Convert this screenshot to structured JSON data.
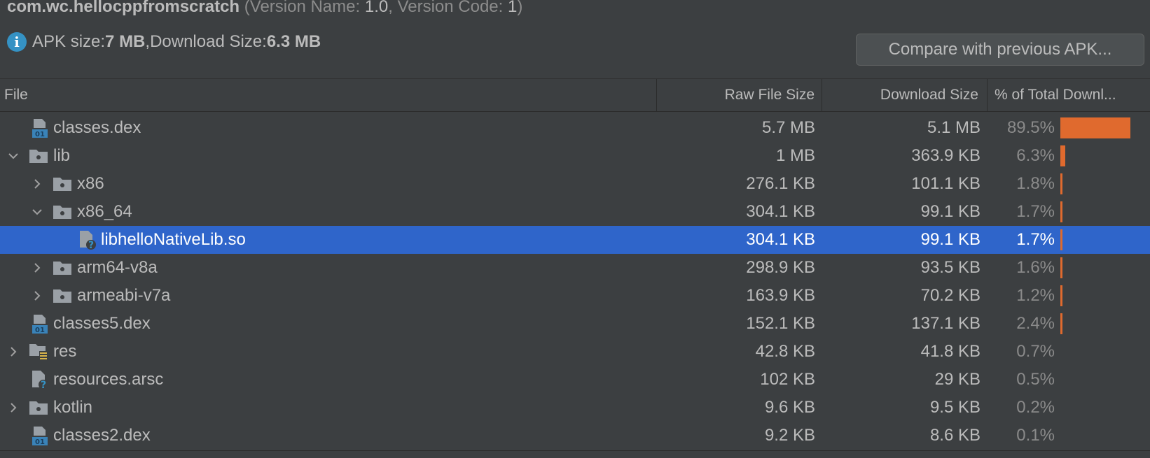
{
  "app": {
    "package": "com.wc.hellocppfromscratch",
    "version_prefix": "(Version Name: ",
    "version_name": "1.0",
    "version_mid": ", Version Code: ",
    "version_code": "1",
    "version_suffix": ")"
  },
  "summary": {
    "apk_size_label": "APK size: ",
    "apk_size": "7 MB",
    "separator": ", ",
    "download_size_label": "Download Size: ",
    "download_size": "6.3 MB"
  },
  "compare_button": "Compare with previous APK...",
  "columns": {
    "file": "File",
    "raw": "Raw File Size",
    "download": "Download Size",
    "percent": "% of Total Downl..."
  },
  "colors": {
    "accent": "#2f65ca",
    "bar": "#e06a2e",
    "info": "#3592c4"
  },
  "rows": [
    {
      "name": "classes.dex",
      "raw": "5.7 MB",
      "download": "5.1 MB",
      "percent": "89.5%",
      "fraction": 0.895,
      "depth": 0,
      "expander": "none",
      "icon": "dex-file-icon"
    },
    {
      "name": "lib",
      "raw": "1 MB",
      "download": "363.9 KB",
      "percent": "6.3%",
      "fraction": 0.063,
      "depth": 0,
      "expander": "expanded",
      "icon": "folder-icon"
    },
    {
      "name": "x86",
      "raw": "276.1 KB",
      "download": "101.1 KB",
      "percent": "1.8%",
      "fraction": 0.018,
      "depth": 1,
      "expander": "collapsed",
      "icon": "folder-icon"
    },
    {
      "name": "x86_64",
      "raw": "304.1 KB",
      "download": "99.1 KB",
      "percent": "1.7%",
      "fraction": 0.017,
      "depth": 1,
      "expander": "expanded",
      "icon": "folder-icon"
    },
    {
      "name": "libhelloNativeLib.so",
      "raw": "304.1 KB",
      "download": "99.1 KB",
      "percent": "1.7%",
      "fraction": 0.017,
      "depth": 2,
      "expander": "none",
      "icon": "unknown-file-icon",
      "selected": true
    },
    {
      "name": "arm64-v8a",
      "raw": "298.9 KB",
      "download": "93.5 KB",
      "percent": "1.6%",
      "fraction": 0.016,
      "depth": 1,
      "expander": "collapsed",
      "icon": "folder-icon"
    },
    {
      "name": "armeabi-v7a",
      "raw": "163.9 KB",
      "download": "70.2 KB",
      "percent": "1.2%",
      "fraction": 0.012,
      "depth": 1,
      "expander": "collapsed",
      "icon": "folder-icon"
    },
    {
      "name": "classes5.dex",
      "raw": "152.1 KB",
      "download": "137.1 KB",
      "percent": "2.4%",
      "fraction": 0.024,
      "depth": 0,
      "expander": "none",
      "icon": "dex-file-icon"
    },
    {
      "name": "res",
      "raw": "42.8 KB",
      "download": "41.8 KB",
      "percent": "0.7%",
      "fraction": 0.007,
      "depth": 0,
      "expander": "collapsed",
      "icon": "resource-folder-icon"
    },
    {
      "name": "resources.arsc",
      "raw": "102 KB",
      "download": "29 KB",
      "percent": "0.5%",
      "fraction": 0.005,
      "depth": 0,
      "expander": "none",
      "icon": "unknown-file-icon"
    },
    {
      "name": "kotlin",
      "raw": "9.6 KB",
      "download": "9.5 KB",
      "percent": "0.2%",
      "fraction": 0.002,
      "depth": 0,
      "expander": "collapsed",
      "icon": "folder-icon"
    },
    {
      "name": "classes2.dex",
      "raw": "9.2 KB",
      "download": "8.6 KB",
      "percent": "0.1%",
      "fraction": 0.001,
      "depth": 0,
      "expander": "none",
      "icon": "dex-file-icon"
    }
  ]
}
